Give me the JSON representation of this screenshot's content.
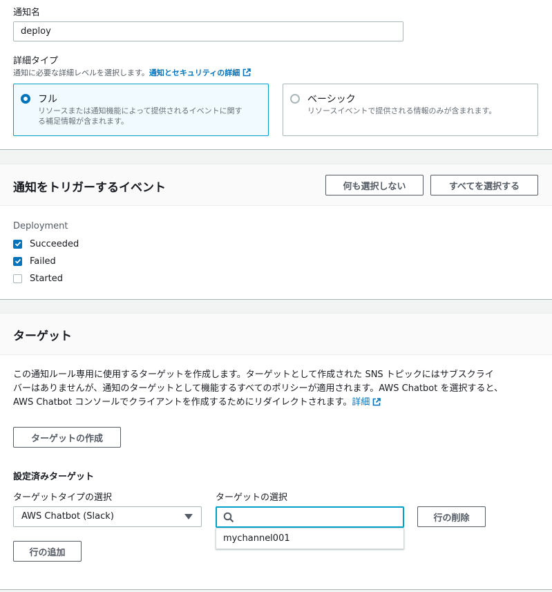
{
  "notification": {
    "name_label": "通知名",
    "name_value": "deploy",
    "detail_type_label": "詳細タイプ",
    "detail_type_desc": "通知に必要な詳細レベルを選択します。",
    "detail_type_link": "通知とセキュリティの詳細",
    "tiles": [
      {
        "title": "フル",
        "desc_line1": "リソースまたは通知機能によって提供されるイベントに関す",
        "desc_line2": "る補足情報が含まれます。",
        "selected": true
      },
      {
        "title": "ベーシック",
        "desc_line1": "リソースイベントで提供される情報のみが含まれます。",
        "desc_line2": "",
        "selected": false
      }
    ]
  },
  "events": {
    "title": "通知をトリガーするイベント",
    "select_none_label": "何も選択しない",
    "select_all_label": "すべてを選択する",
    "group_label": "Deployment",
    "items": [
      {
        "label": "Succeeded",
        "checked": true
      },
      {
        "label": "Failed",
        "checked": true
      },
      {
        "label": "Started",
        "checked": false
      }
    ]
  },
  "targets": {
    "title": "ターゲット",
    "description_line1": "この通知ルール専用に使用するターゲットを作成します。ターゲットとして作成された SNS トピックにはサブスクライ",
    "description_line2": "バーはありませんが、通知のターゲットとして機能するすべてのポリシーが適用されます。AWS Chatbot を選択すると、",
    "description_line3": "AWS Chatbot コンソールでクライアントを作成するためにリダイレクトされます。",
    "description_link": "詳細",
    "create_target_label": "ターゲットの作成",
    "configured_label": "設定済みターゲット",
    "type_select_label": "ターゲットタイプの選択",
    "type_select_value": "AWS Chatbot (Slack)",
    "target_select_label": "ターゲットの選択",
    "target_search_value": "",
    "dropdown_options": [
      "mychannel001"
    ],
    "delete_row_label": "行の削除",
    "add_row_label": "行の追加"
  },
  "colors": {
    "accent": "#0073bb",
    "focus": "#00a1c9",
    "selected_tile_bg": "#f1faff"
  }
}
